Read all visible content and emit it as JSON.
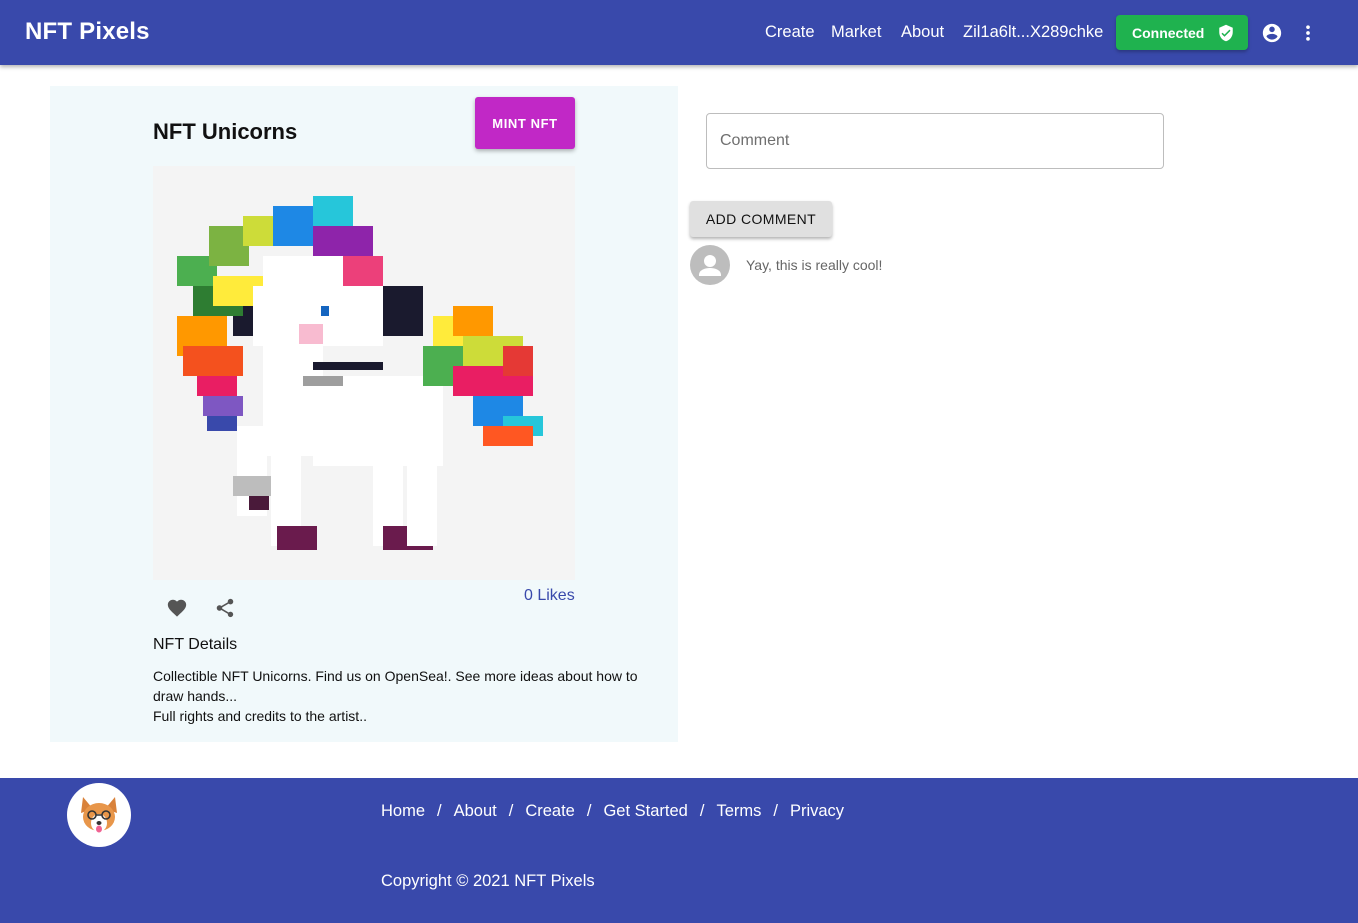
{
  "header": {
    "brand": "NFT Pixels",
    "nav": [
      "Create",
      "Market",
      "About"
    ],
    "wallet": "Zil1a6lt...X289chke",
    "connected_label": "Connected"
  },
  "nft": {
    "title": "NFT Unicorns",
    "mint_label": "MINT NFT",
    "likes_label": "0 Likes",
    "details_heading": "NFT Details",
    "description_line1": "Collectible NFT Unicorns. Find us on OpenSea!. See more ideas about how to draw hands...",
    "description_line2": "Full rights and credits to the artist.."
  },
  "comments": {
    "placeholder": "Comment",
    "add_label": "ADD COMMENT",
    "items": [
      {
        "text": "Yay, this is really cool!"
      }
    ]
  },
  "footer": {
    "links": [
      "Home",
      "About",
      "Create",
      "Get Started",
      "Terms",
      "Privacy"
    ],
    "copyright": "Copyright © 2021 NFT Pixels"
  },
  "colors": {
    "primary": "#3949ab",
    "mint": "#c128c6",
    "connected": "#1fb24f",
    "card_bg": "#f1f9fb"
  }
}
